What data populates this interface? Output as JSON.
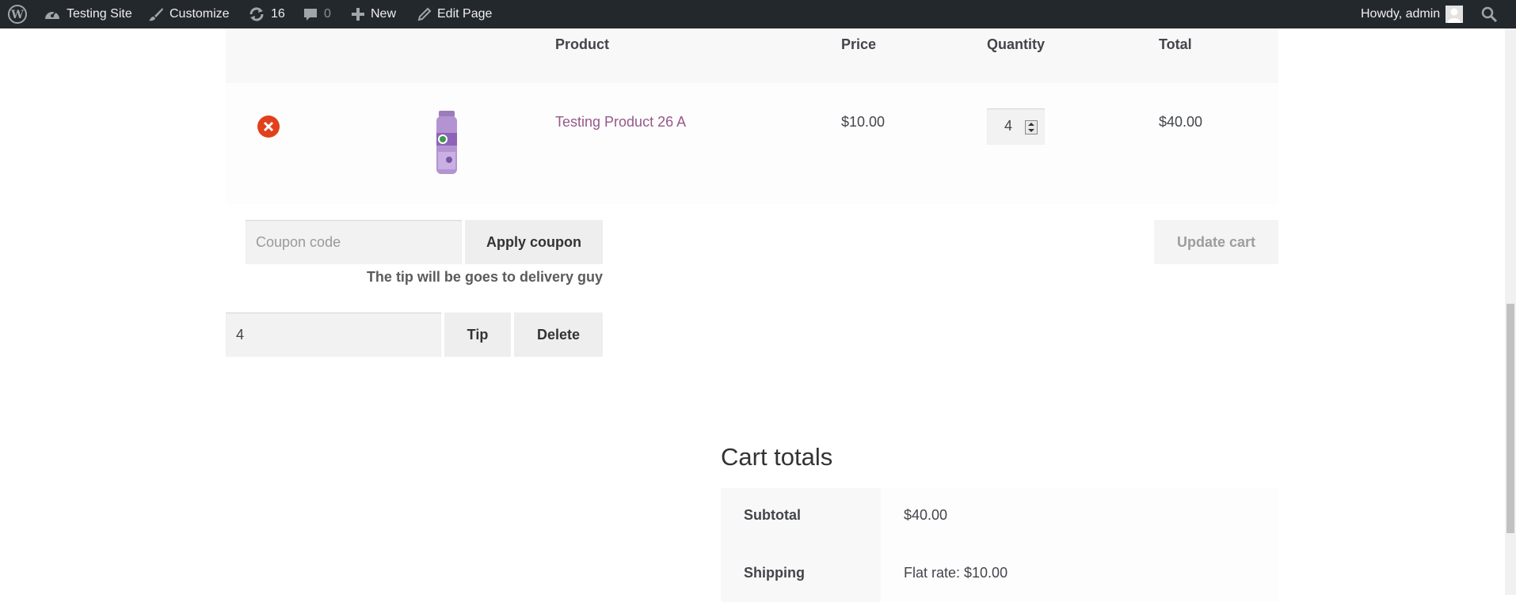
{
  "adminbar": {
    "site_name": "Testing Site",
    "customize": "Customize",
    "updates_count": "16",
    "comments_count": "0",
    "new_label": "New",
    "edit_page": "Edit Page",
    "howdy": "Howdy, admin"
  },
  "cart": {
    "headers": {
      "product": "Product",
      "price": "Price",
      "quantity": "Quantity",
      "total": "Total"
    },
    "item": {
      "name": "Testing Product 26 A",
      "price": "$10.00",
      "quantity": "4",
      "total": "$40.00"
    },
    "coupon_placeholder": "Coupon code",
    "apply_coupon": "Apply coupon",
    "update_cart": "Update cart",
    "tip_note": "The tip will be goes to delivery guy",
    "tip_value": "4",
    "tip_button": "Tip",
    "delete_button": "Delete"
  },
  "totals": {
    "title": "Cart totals",
    "rows": [
      {
        "label": "Subtotal",
        "value": "$40.00"
      },
      {
        "label": "Shipping",
        "value": "Flat rate: $10.00"
      }
    ]
  },
  "colors": {
    "adminbar_bg": "#23282d",
    "link": "#96588a",
    "remove": "#e2401c"
  }
}
